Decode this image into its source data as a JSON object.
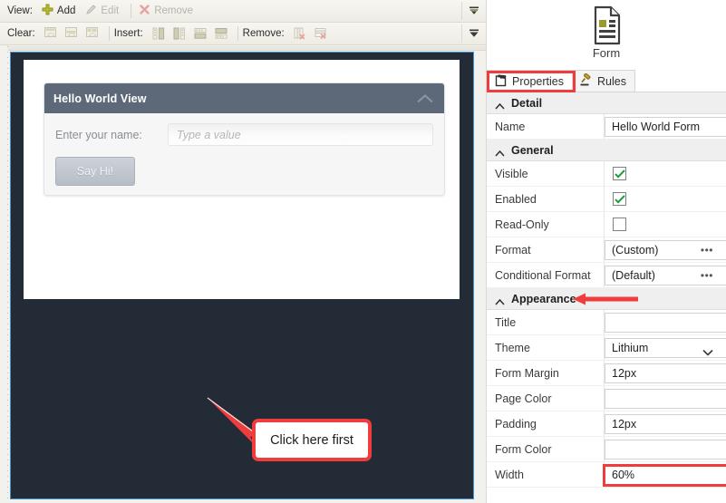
{
  "toolbars": {
    "row1": {
      "label": "View:",
      "items": [
        {
          "label": "Add",
          "icon": "plus-icon",
          "enabled": true
        },
        {
          "label": "Edit",
          "icon": "pencil-icon",
          "enabled": false
        },
        {
          "label": "Remove",
          "icon": "x-icon",
          "enabled": false
        }
      ],
      "overflow_icon": "overflow-chevron-icon"
    },
    "row2": {
      "groups": [
        {
          "label": "Clear:",
          "icons": [
            "clear-view-icon",
            "clear-layout-icon",
            "clear-all-icon"
          ]
        },
        {
          "label": "Insert:",
          "icons": [
            "insert-column-left-icon",
            "insert-column-right-icon",
            "insert-row-above-icon",
            "insert-row-below-icon"
          ]
        },
        {
          "label": "Remove:",
          "icons": [
            "remove-column-icon",
            "remove-row-icon"
          ]
        }
      ],
      "overflow_icon": "overflow-chevron-icon"
    }
  },
  "canvas": {
    "panel": {
      "title": "Hello World View",
      "collapse_icon": "chevron-up-icon",
      "field_label": "Enter your name:",
      "field_placeholder": "Type a value",
      "field_value": "",
      "button_label": "Say Hi!"
    },
    "callout": {
      "text": "Click here first",
      "border_color": "#ef3d3d"
    }
  },
  "inspector": {
    "object": {
      "icon": "form-document-icon",
      "label": "Form"
    },
    "tabs": [
      {
        "label": "Properties",
        "icon": "clipboard-icon",
        "active": true,
        "highlighted": true
      },
      {
        "label": "Rules",
        "icon": "gavel-icon",
        "active": false,
        "highlighted": false
      }
    ],
    "groups": [
      {
        "title": "Detail",
        "collapse_icon": "chevron-up-icon",
        "annotated": false,
        "rows": [
          {
            "name": "Name",
            "type": "text",
            "value": "Hello World Form",
            "highlighted": false
          }
        ]
      },
      {
        "title": "General",
        "collapse_icon": "chevron-up-icon",
        "annotated": false,
        "rows": [
          {
            "name": "Visible",
            "type": "checkbox",
            "checked": true
          },
          {
            "name": "Enabled",
            "type": "checkbox",
            "checked": true
          },
          {
            "name": "Read-Only",
            "type": "checkbox",
            "checked": false
          },
          {
            "name": "Format",
            "type": "ellipsis",
            "value": "(Custom)"
          },
          {
            "name": "Conditional Format",
            "type": "ellipsis",
            "value": "(Default)"
          }
        ]
      },
      {
        "title": "Appearance",
        "collapse_icon": "chevron-up-icon",
        "annotated": true,
        "rows": [
          {
            "name": "Title",
            "type": "text",
            "value": ""
          },
          {
            "name": "Theme",
            "type": "dropdown",
            "value": "Lithium"
          },
          {
            "name": "Form Margin",
            "type": "text",
            "value": "12px"
          },
          {
            "name": "Page Color",
            "type": "text",
            "value": ""
          },
          {
            "name": "Padding",
            "type": "text",
            "value": "12px"
          },
          {
            "name": "Form Color",
            "type": "text",
            "value": ""
          },
          {
            "name": "Width",
            "type": "text",
            "value": "60%",
            "highlighted": true
          }
        ]
      }
    ]
  },
  "colors": {
    "annotation_red": "#ef3d3d",
    "canvas_dark": "#222b36",
    "canvas_border_blue": "#3d92e0",
    "panel_header": "#5d6979"
  }
}
